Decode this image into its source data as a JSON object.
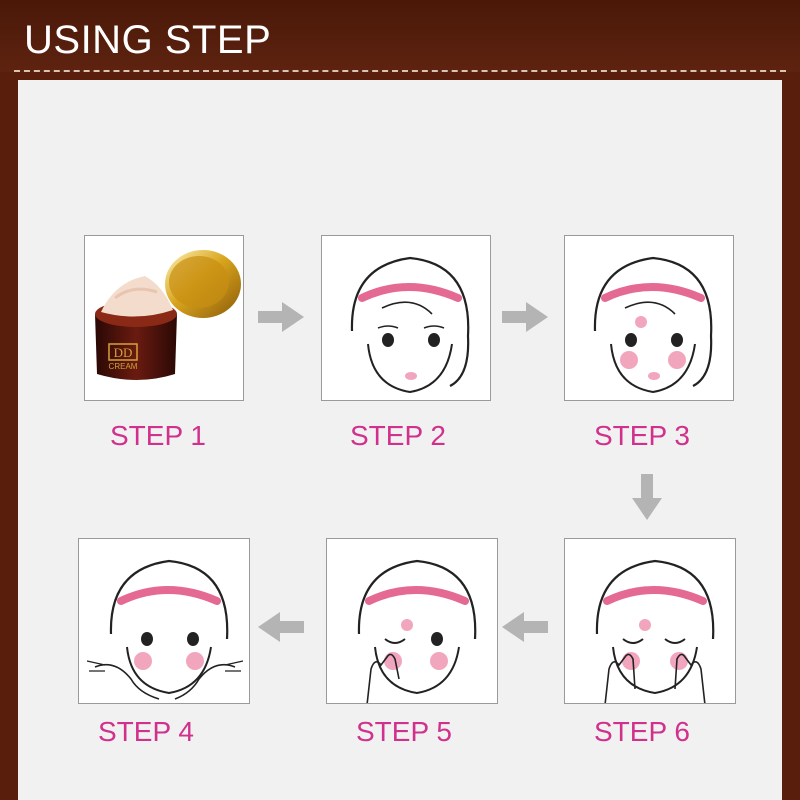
{
  "header": {
    "title": "USING STEP"
  },
  "product": {
    "jar_label": "DD",
    "jar_sublabel": "CREAM"
  },
  "steps": [
    {
      "label": "STEP 1",
      "image": "cream-jar"
    },
    {
      "label": "STEP 2",
      "image": "face-clean"
    },
    {
      "label": "STEP 3",
      "image": "face-dotted-cream"
    },
    {
      "label": "STEP 4",
      "image": "face-spread-hands"
    },
    {
      "label": "STEP 5",
      "image": "face-pat-cheek"
    },
    {
      "label": "STEP 6",
      "image": "face-press-hands"
    }
  ],
  "colors": {
    "frame": "#5a1f0c",
    "panel": "#f1f1f1",
    "step_label": "#d1318d",
    "arrow": "#b4b4b4",
    "blush": "#f2a6bd",
    "headband": "#e46a93"
  }
}
